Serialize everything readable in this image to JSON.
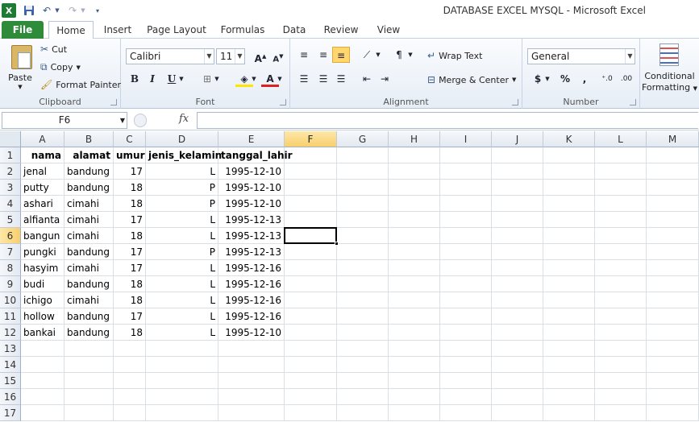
{
  "window": {
    "title": "DATABASE EXCEL MYSQL  -  Microsoft Excel"
  },
  "quick_access": {
    "app_icon": "excel-icon",
    "save_icon": "save-icon",
    "undo_icon": "undo-icon",
    "redo_icon": "redo-icon",
    "customize_icon": "customize-icon"
  },
  "tabs": [
    "File",
    "Home",
    "Insert",
    "Page Layout",
    "Formulas",
    "Data",
    "Review",
    "View"
  ],
  "active_tab": "Home",
  "ribbon": {
    "clipboard": {
      "label": "Clipboard",
      "paste": "Paste",
      "cut": "Cut",
      "copy": "Copy",
      "format_painter": "Format Painter"
    },
    "font": {
      "label": "Font",
      "font_name": "Calibri",
      "font_size": "11"
    },
    "alignment": {
      "label": "Alignment",
      "wrap_text": "Wrap Text",
      "merge_center": "Merge & Center"
    },
    "number": {
      "label": "Number",
      "format": "General",
      "currency": "$",
      "percent": "%",
      "comma": ","
    },
    "styles": {
      "conditional": "Conditional",
      "formatting": "Formatting"
    }
  },
  "formula_bar": {
    "name_box": "F6",
    "fx": "fx",
    "value": ""
  },
  "sheet": {
    "columns": [
      "A",
      "B",
      "C",
      "D",
      "E",
      "F",
      "G",
      "H",
      "I",
      "J",
      "K",
      "L",
      "M"
    ],
    "selected_column": "F",
    "selected_row": 6,
    "rows": [
      [
        "nama",
        "alamat",
        "umur",
        "jenis_kelamin",
        "tanggal_lahir"
      ],
      [
        "jenal",
        "bandung",
        "17",
        "L",
        "1995-12-10"
      ],
      [
        "putty",
        "bandung",
        "18",
        "P",
        "1995-12-10"
      ],
      [
        "ashari",
        "cimahi",
        "18",
        "P",
        "1995-12-10"
      ],
      [
        "alfianta",
        "cimahi",
        "17",
        "L",
        "1995-12-13"
      ],
      [
        "bangun",
        "cimahi",
        "18",
        "L",
        "1995-12-13"
      ],
      [
        "pungki",
        "bandung",
        "17",
        "P",
        "1995-12-13"
      ],
      [
        "hasyim",
        "cimahi",
        "17",
        "L",
        "1995-12-16"
      ],
      [
        "budi",
        "bandung",
        "18",
        "L",
        "1995-12-16"
      ],
      [
        "ichigo",
        "cimahi",
        "18",
        "L",
        "1995-12-16"
      ],
      [
        "hollow",
        "bandung",
        "17",
        "L",
        "1995-12-16"
      ],
      [
        "bankai",
        "bandung",
        "18",
        "L",
        "1995-12-10"
      ]
    ],
    "row_numbers": [
      "1",
      "2",
      "3",
      "4",
      "5",
      "6",
      "7",
      "8",
      "9",
      "10",
      "11",
      "12",
      "13",
      "14",
      "15",
      "16",
      "17"
    ]
  }
}
